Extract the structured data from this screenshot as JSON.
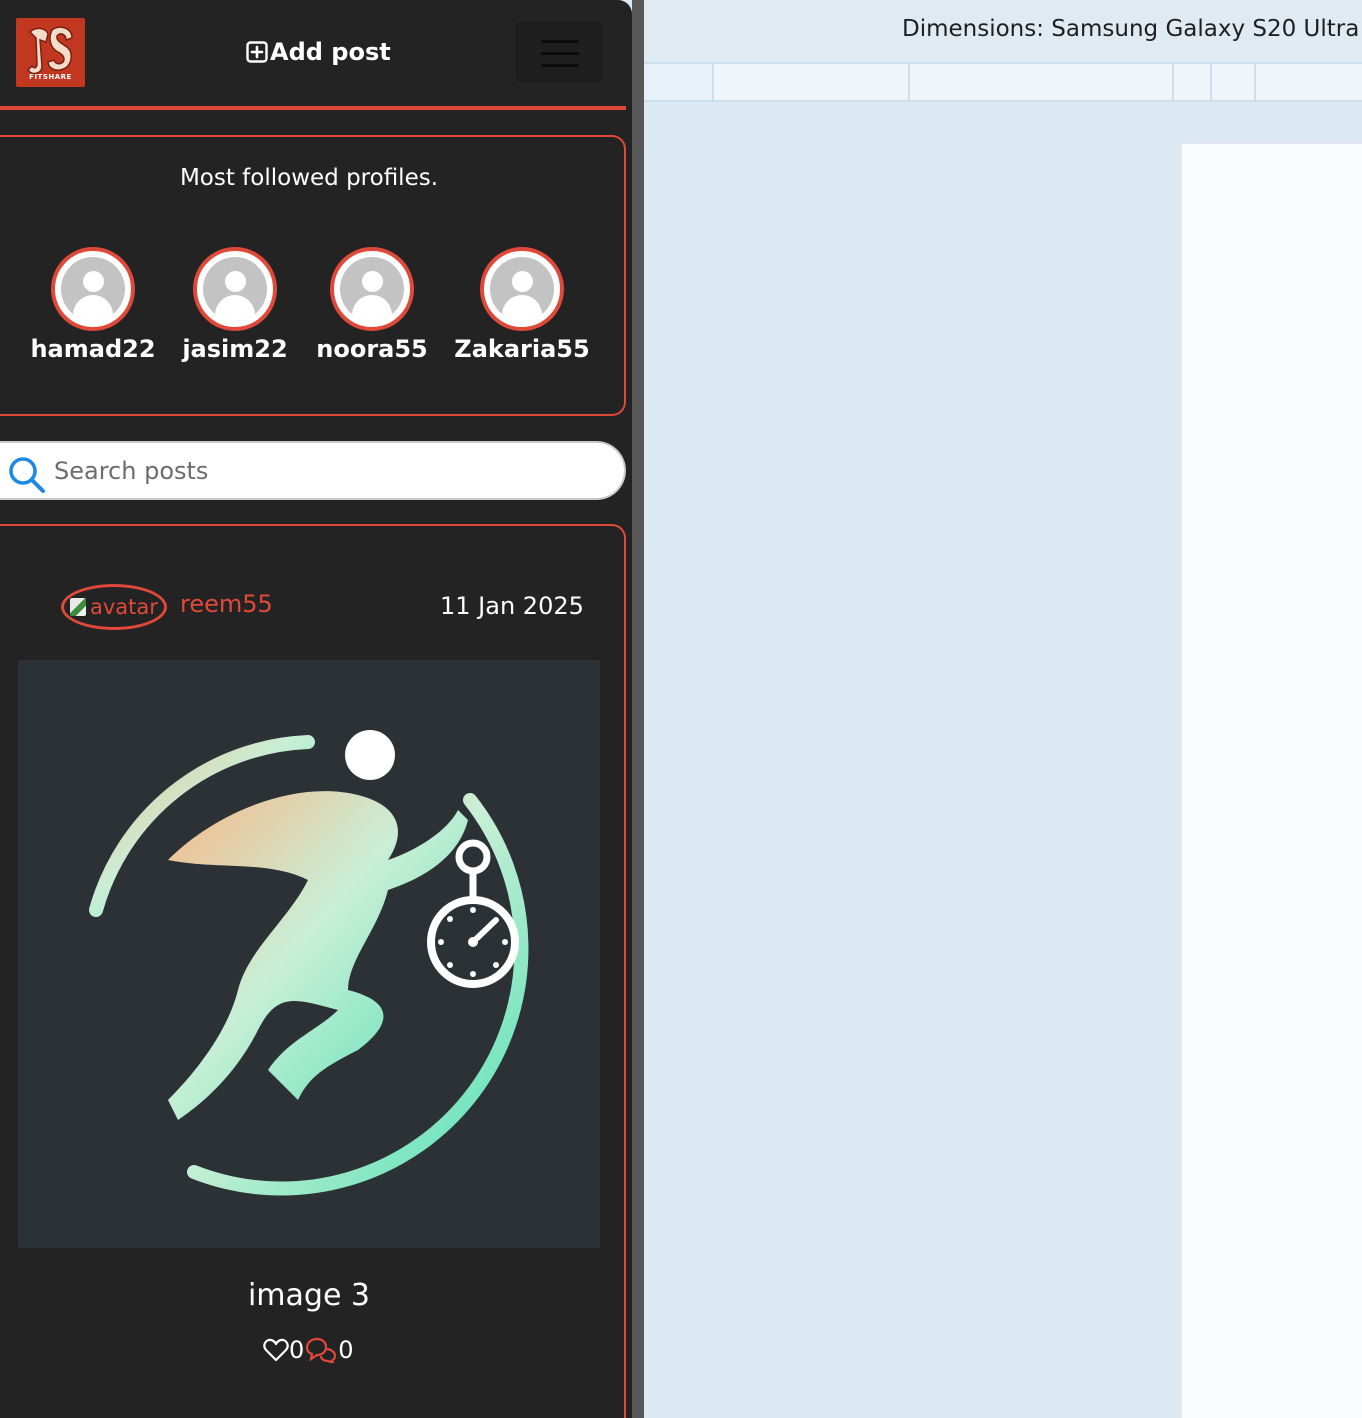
{
  "navbar": {
    "logo_text": "FITSHARE",
    "add_post_label": "Add post",
    "menu_icon": "hamburger-icon"
  },
  "profiles": {
    "title": "Most followed profiles.",
    "items": [
      {
        "name": "hamad22"
      },
      {
        "name": "jasim22"
      },
      {
        "name": "noora55"
      },
      {
        "name": "Zakaria55"
      }
    ]
  },
  "search": {
    "placeholder": "Search posts",
    "icon": "search-icon"
  },
  "post": {
    "avatar_alt": "avatar",
    "username": "reem55",
    "date": "11 Jan 2025",
    "title": "image 3",
    "likes": "0",
    "comments": "0"
  },
  "devtools": {
    "dimensions_label": "Dimensions: Samsung Galaxy S20 Ultra"
  },
  "colors": {
    "accent": "#e0493a",
    "app_bg": "#232323",
    "devtools_bg": "#dde9f2"
  }
}
